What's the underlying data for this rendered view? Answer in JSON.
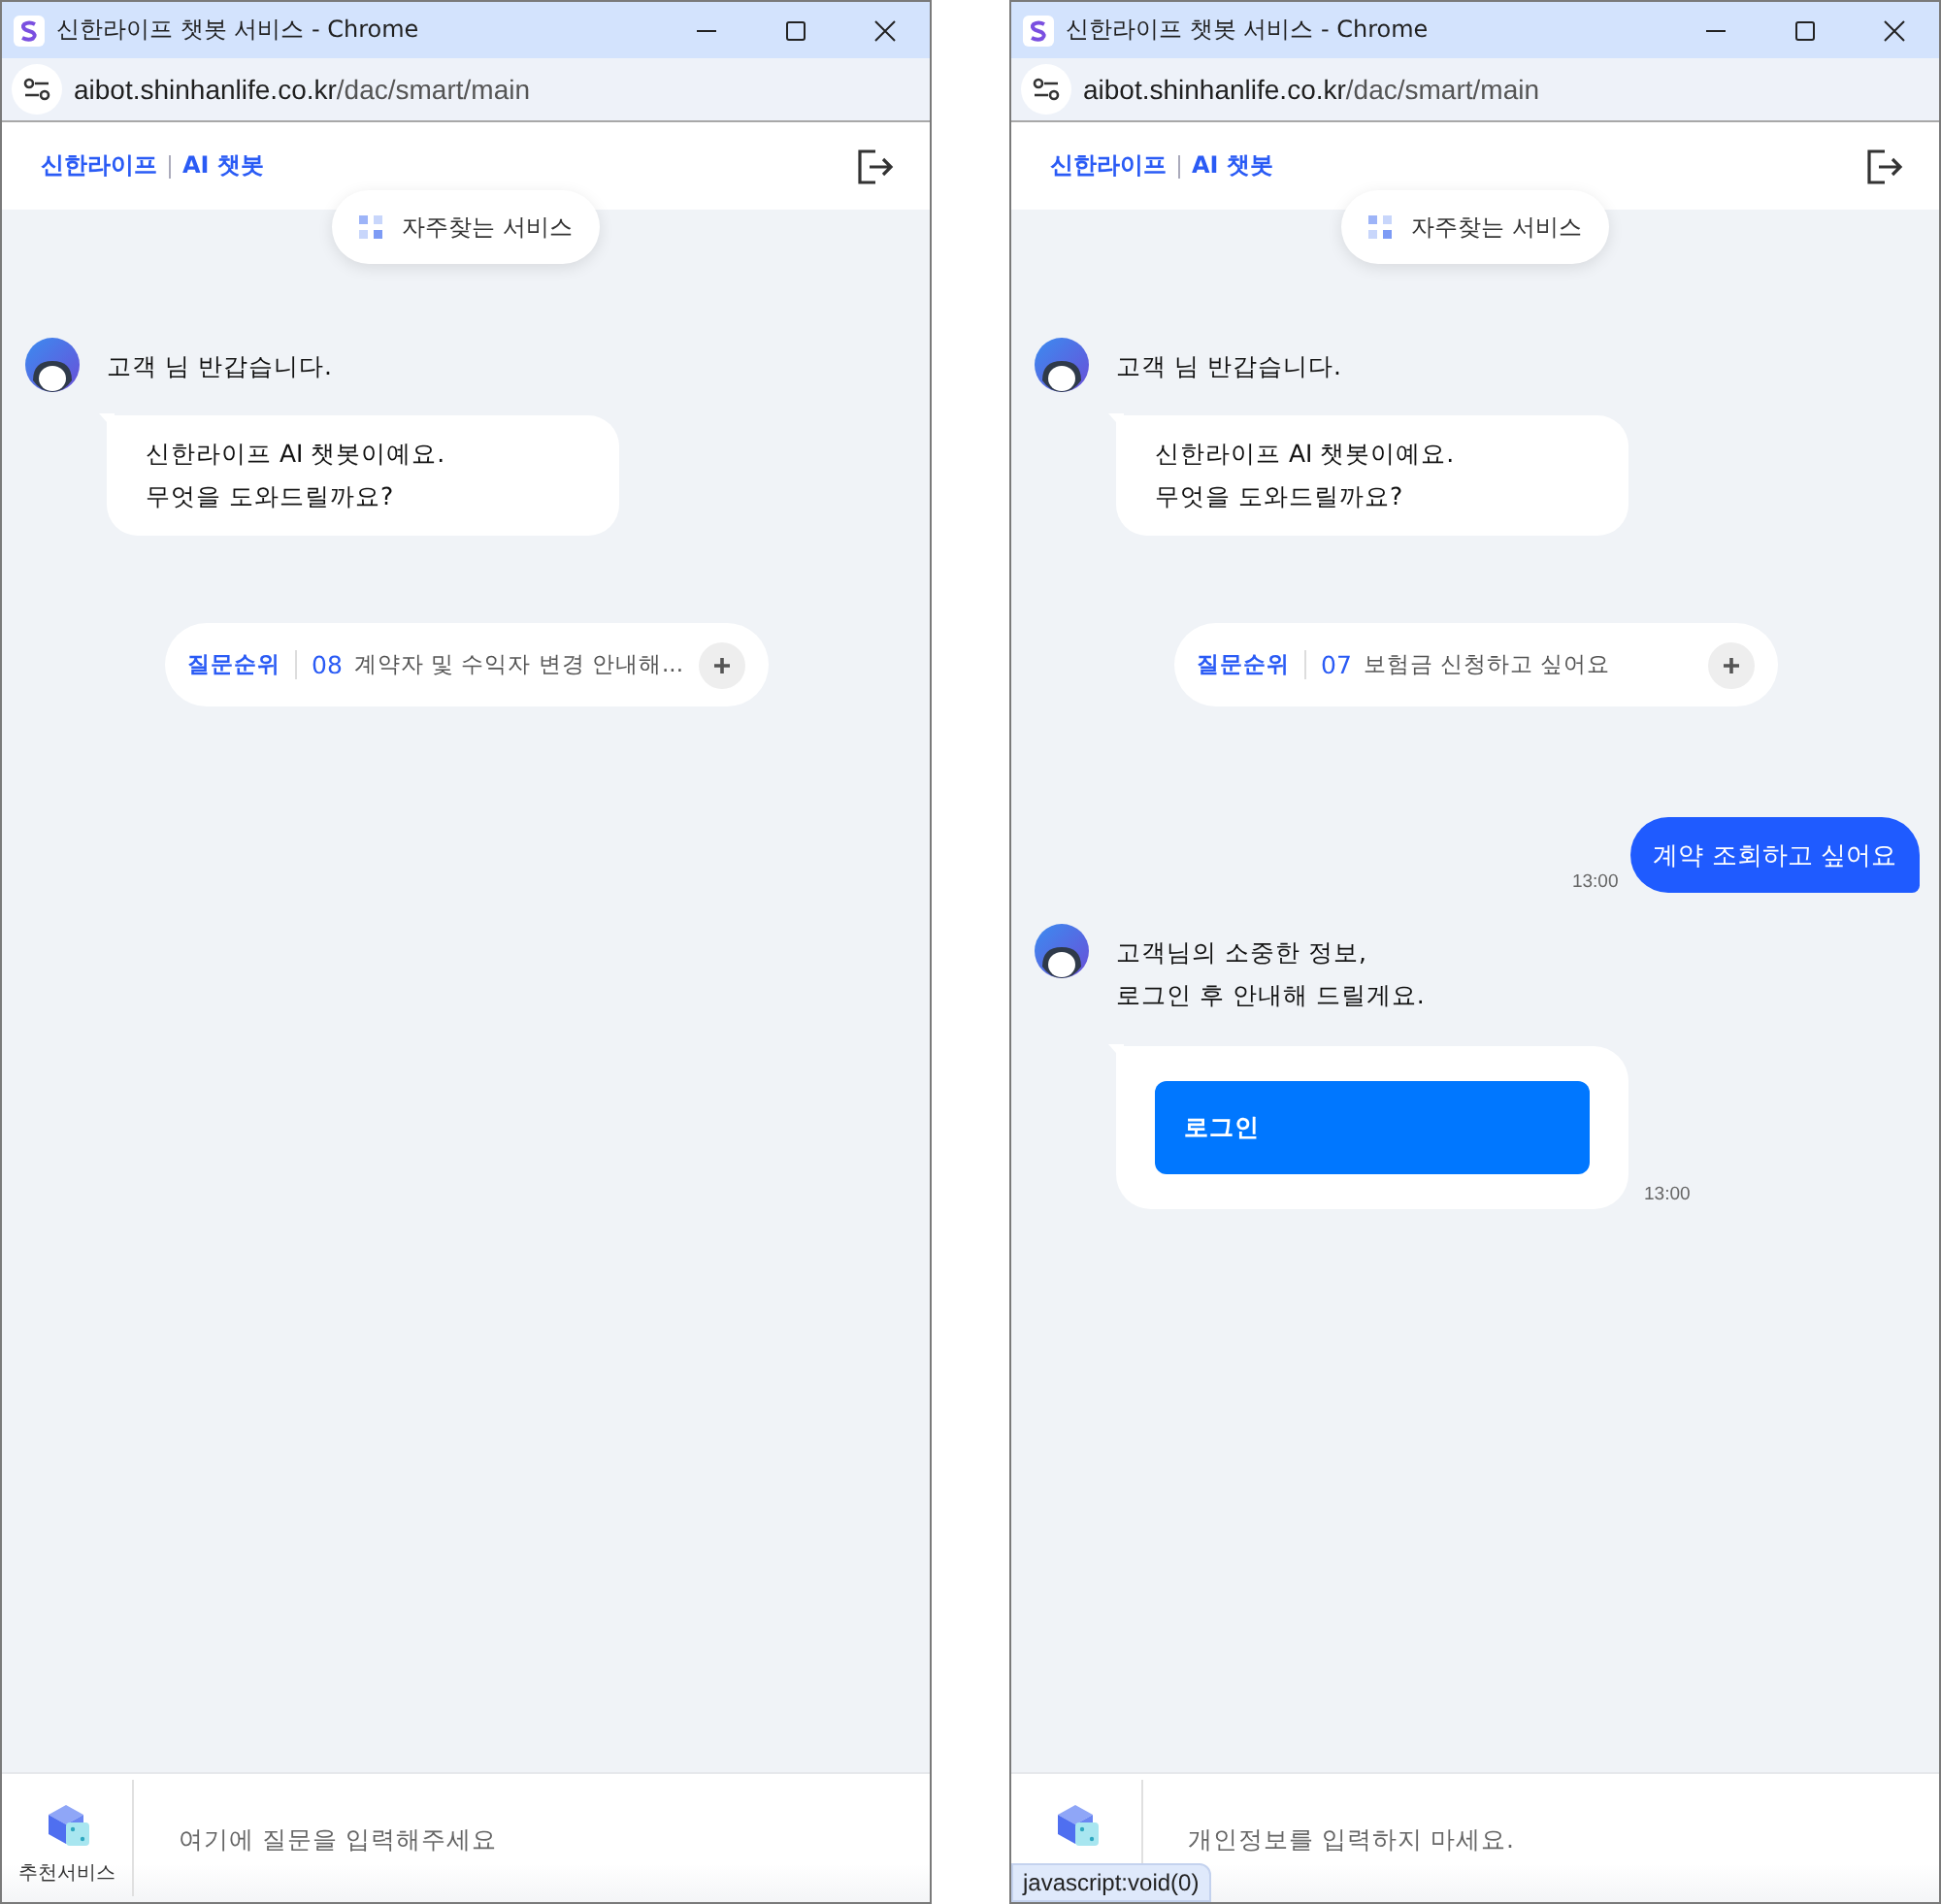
{
  "windows": [
    {
      "title": "신한라이프 챗봇 서비스 - Chrome",
      "url_host": "aibot.shinhanlife.co.kr",
      "url_path": "/dac/smart/main",
      "brand": "신한라이프",
      "brand_sub": "AI 챗봇",
      "faq_button": "자주찾는 서비스",
      "messages": [
        {
          "kind": "greeting",
          "text": "고객 님 반갑습니다."
        },
        {
          "kind": "bubble",
          "lines": [
            "신한라이프 AI 챗봇이예요.",
            "무엇을 도와드릴까요?"
          ]
        },
        {
          "kind": "ranking",
          "label": "질문순위",
          "number": "08",
          "text": "계약자 및 수익자 변경 안내해..."
        }
      ],
      "recommend_label": "추천서비스",
      "input_placeholder": "여기에 질문을 입력해주세요"
    },
    {
      "title": "신한라이프 챗봇 서비스 - Chrome",
      "url_host": "aibot.shinhanlife.co.kr",
      "url_path": "/dac/smart/main",
      "brand": "신한라이프",
      "brand_sub": "AI 챗봇",
      "faq_button": "자주찾는 서비스",
      "messages": [
        {
          "kind": "greeting",
          "text": "고객 님 반갑습니다."
        },
        {
          "kind": "bubble",
          "lines": [
            "신한라이프 AI 챗봇이예요.",
            "무엇을 도와드릴까요?"
          ]
        },
        {
          "kind": "ranking",
          "label": "질문순위",
          "number": "07",
          "text": "보험금 신청하고 싶어요"
        },
        {
          "kind": "user",
          "text": "계약 조회하고 싶어요",
          "time": "13:00"
        },
        {
          "kind": "login",
          "lines": [
            "고객님의 소중한 정보,",
            "로그인 후 안내해 드릴게요."
          ],
          "button": "로그인",
          "time": "13:00"
        }
      ],
      "input_placeholder": "개인정보를 입력하지 마세요.",
      "status_link": "javascript:void(0)"
    }
  ]
}
